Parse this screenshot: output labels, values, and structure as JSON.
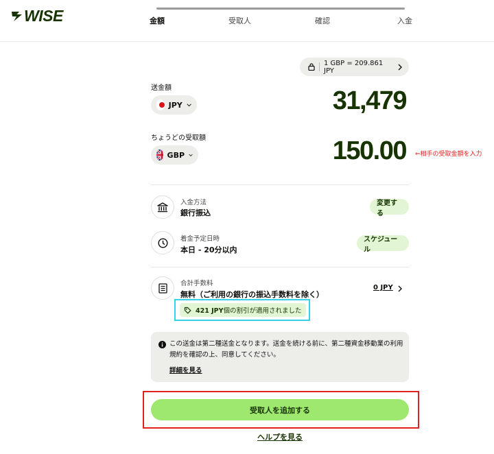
{
  "header": {
    "logo_text": "WISE",
    "steps": [
      {
        "label": "金額",
        "active": true
      },
      {
        "label": "受取人",
        "active": false
      },
      {
        "label": "確認",
        "active": false
      },
      {
        "label": "入金",
        "active": false
      }
    ]
  },
  "rate": {
    "text": "1 GBP = 209.861 JPY"
  },
  "send": {
    "label": "送金額",
    "currency": "JPY",
    "amount": "31,479"
  },
  "receive": {
    "label": "ちょうどの受取額",
    "currency": "GBP",
    "amount": "150.00"
  },
  "annotation": "⇐相手の受取金額を入力",
  "payment": {
    "sub": "入金方法",
    "main": "銀行振込",
    "action": "変更する"
  },
  "arrival": {
    "sub": "着金予定日時",
    "main": "本日 - 20分以内",
    "action": "スケジュール"
  },
  "fees": {
    "sub": "合計手数料",
    "main": "無料（ご利用の銀行の振込手数料を除く）",
    "amount": "0 JPY",
    "discount_amount": "421 JPY",
    "discount_text": "個の割引が適用されました"
  },
  "notice": {
    "text": "この送金は第二種送金となります。送金を続ける前に、第二種資金移動業の利用規約を確認の上、同意してください。",
    "link": "詳細を見る"
  },
  "cta": {
    "label": "受取人を追加する"
  },
  "help": {
    "label": "ヘルプを見る"
  },
  "colors": {
    "brand_green": "#163300",
    "accent_green": "#9fe870",
    "pill_green": "#e2f6d5",
    "annotation_red": "#e3211c",
    "highlight_cyan": "#34d3e6"
  }
}
